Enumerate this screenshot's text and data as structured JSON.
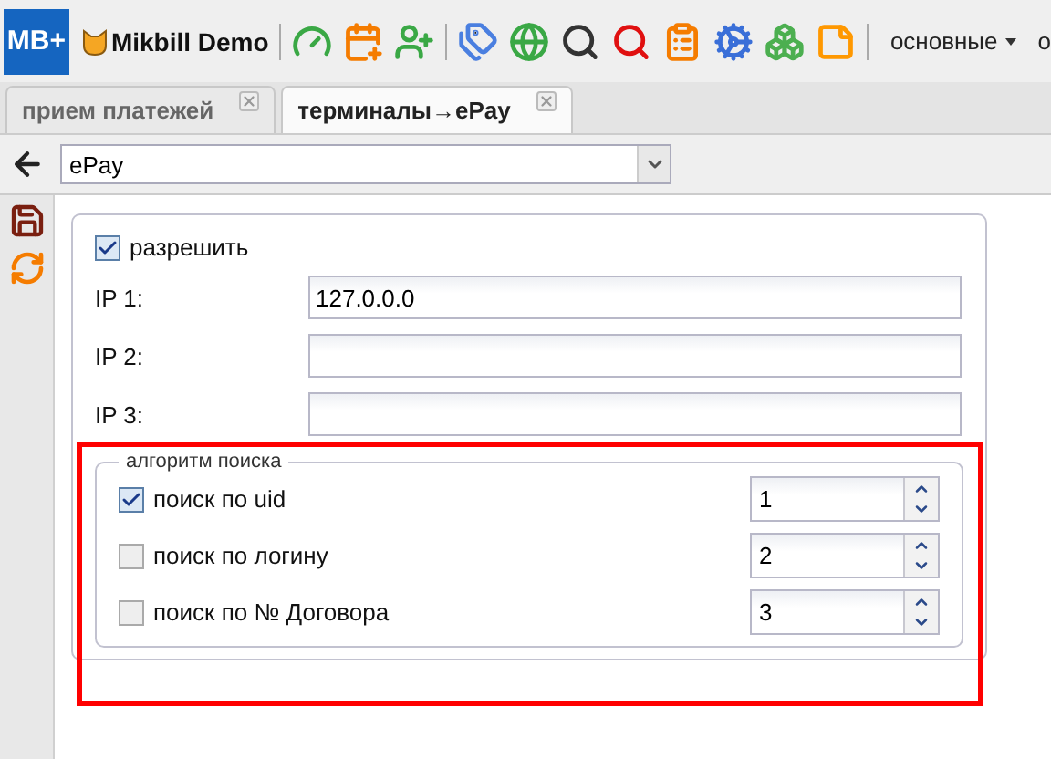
{
  "app": {
    "logo": "MB+",
    "title": "Mikbill Demo"
  },
  "menus": [
    {
      "label": "основные",
      "dropdown": true
    },
    {
      "label": "о",
      "dropdown": false
    }
  ],
  "tabs": [
    {
      "label": "прием платежей",
      "selected": false
    },
    {
      "label": "терминалы→ePay",
      "selected": true
    }
  ],
  "selector": {
    "value": "ePay"
  },
  "form": {
    "enable": {
      "label": "разрешить",
      "checked": true
    },
    "ip_fields": [
      {
        "label": "IP 1:",
        "value": "127.0.0.0"
      },
      {
        "label": "IP 2:"
      },
      {
        "label": "IP 3:"
      }
    ],
    "search_group": {
      "legend": "алгоритм поиска",
      "options": [
        {
          "label": "поиск по uid",
          "checked": true,
          "value": "1"
        },
        {
          "label": "поиск по логину",
          "checked": false,
          "value": "2"
        },
        {
          "label": "поиск по № Договора",
          "checked": false,
          "value": "3"
        }
      ]
    }
  }
}
